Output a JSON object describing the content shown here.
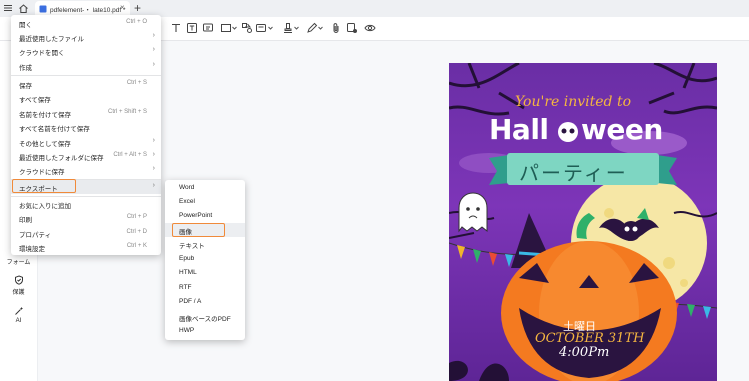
{
  "titlebar": {
    "tab_label": "pdfelement-・ late10.pdf *",
    "tab_close": "×",
    "new_tab": "+"
  },
  "left_rail": {
    "form_label": "フォーム",
    "protect_label": "保護",
    "ai_label": "AI"
  },
  "main_menu": {
    "items": [
      {
        "label": "開く",
        "shortcut": "Ctrl + O",
        "arrow": ""
      },
      {
        "label": "最近使用したファイル",
        "shortcut": "",
        "arrow": "›"
      },
      {
        "label": "クラウドを開く",
        "shortcut": "",
        "arrow": "›"
      },
      {
        "label": "作成",
        "shortcut": "",
        "arrow": "›"
      },
      {
        "label": "保存",
        "shortcut": "Ctrl + S",
        "arrow": ""
      },
      {
        "label": "すべて保存",
        "shortcut": "",
        "arrow": ""
      },
      {
        "label": "名前を付けて保存",
        "shortcut": "Ctrl + Shift + S",
        "arrow": ""
      },
      {
        "label": "すべて名前を付けて保存",
        "shortcut": "",
        "arrow": ""
      },
      {
        "label": "その他として保存",
        "shortcut": "",
        "arrow": "›"
      },
      {
        "label": "最近使用したフォルダに保存",
        "shortcut": "Ctrl + Alt + S",
        "arrow": "›"
      },
      {
        "label": "クラウドに保存",
        "shortcut": "",
        "arrow": "›"
      },
      {
        "label": "エクスポート",
        "shortcut": "",
        "arrow": "›"
      },
      {
        "label": "お気に入りに追加",
        "shortcut": "",
        "arrow": ""
      },
      {
        "label": "印刷",
        "shortcut": "Ctrl + P",
        "arrow": ""
      },
      {
        "label": "プロパティ",
        "shortcut": "Ctrl + D",
        "arrow": ""
      },
      {
        "label": "環境設定",
        "shortcut": "Ctrl + K",
        "arrow": ""
      }
    ]
  },
  "export_submenu": {
    "items": [
      {
        "label": "Word"
      },
      {
        "label": "Excel"
      },
      {
        "label": "PowerPoint"
      },
      {
        "label": "画像"
      },
      {
        "label": "テキスト"
      },
      {
        "label": "Epub"
      },
      {
        "label": "HTML"
      },
      {
        "label": "RTF"
      },
      {
        "label": "PDF / A"
      },
      {
        "label": "画像ベースのPDF"
      },
      {
        "label": "HWP"
      }
    ]
  },
  "poster": {
    "invite": "You're invited to",
    "title_left": "Hall",
    "title_right": "ween",
    "party": "パーティー",
    "day": "土曜日",
    "date": "OCTOBER 31TH",
    "time": "4:00Pm"
  }
}
